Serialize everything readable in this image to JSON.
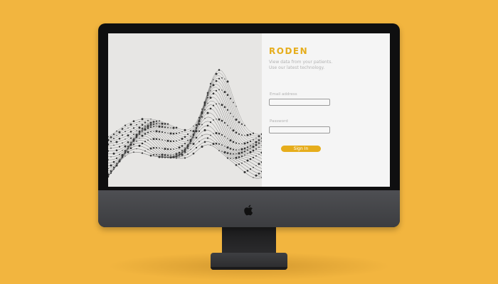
{
  "app": {
    "brand": "RODEN",
    "tagline": [
      "View data from your patients.",
      "Use our latest technology."
    ]
  },
  "login": {
    "email_label": "Email address",
    "email_value": "",
    "password_label": "Password",
    "password_value": "",
    "signin_label": "Sign In"
  },
  "device": {
    "logo_icon": "apple-logo-icon"
  },
  "colors": {
    "accent": "#e6ad1c",
    "background": "#f2b53f",
    "bezel": "#0f0f10",
    "chin": "#4a4b4f"
  }
}
